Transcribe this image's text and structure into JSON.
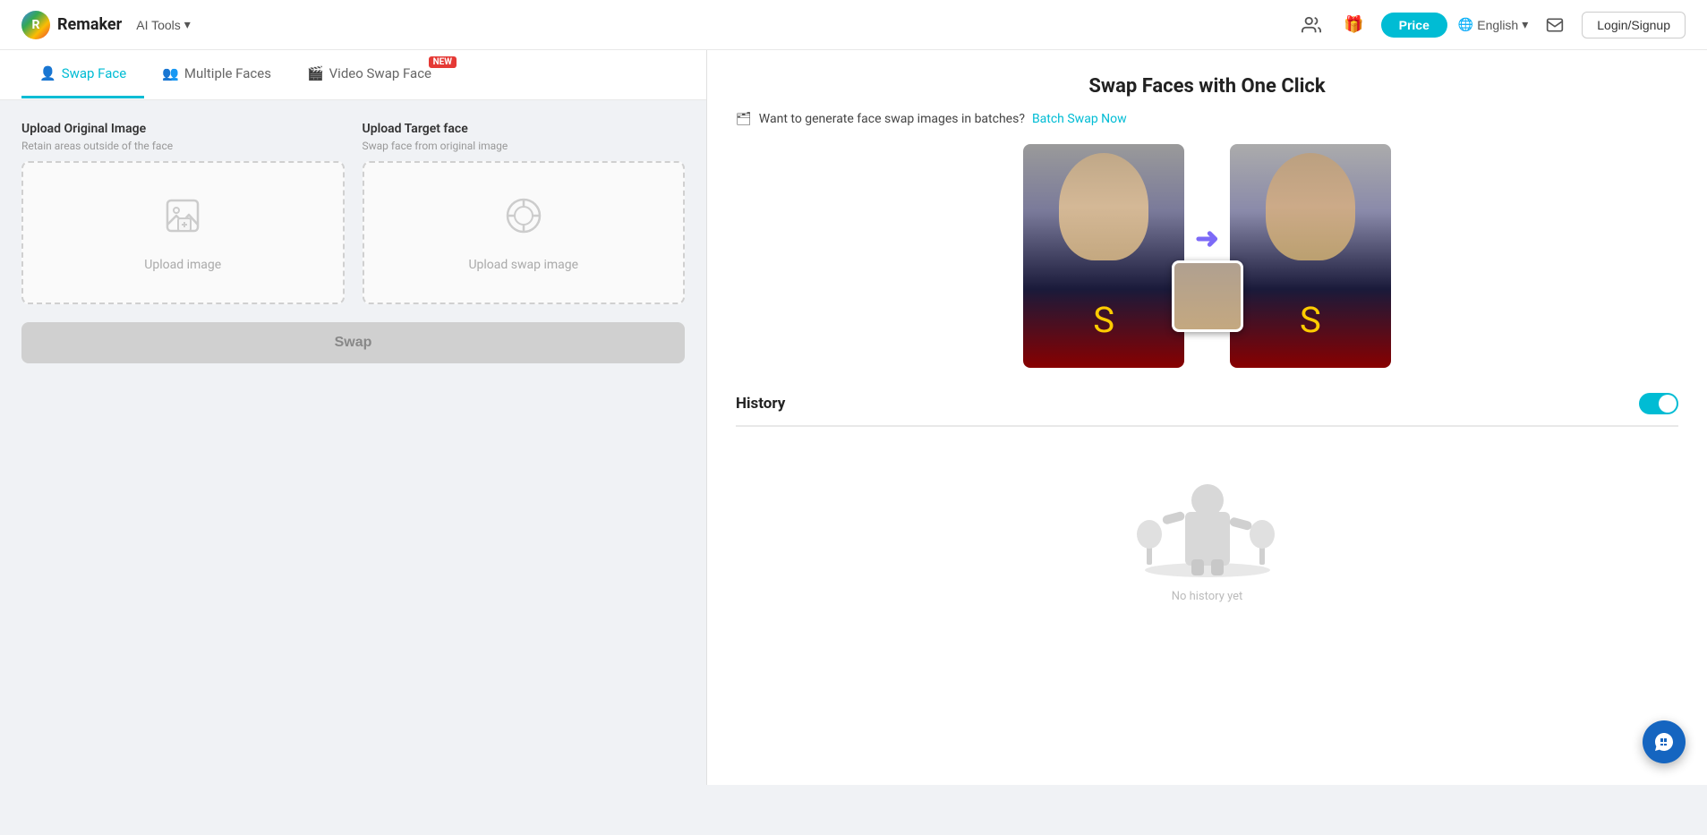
{
  "header": {
    "brand": "Remaker",
    "ai_tools_label": "AI Tools",
    "price_label": "Price",
    "language": "English",
    "login_label": "Login/Signup"
  },
  "tabs": [
    {
      "id": "swap-face",
      "label": "Swap Face",
      "active": true,
      "icon": "👤",
      "badge": null
    },
    {
      "id": "multiple-faces",
      "label": "Multiple Faces",
      "active": false,
      "icon": "👥",
      "badge": null
    },
    {
      "id": "video-swap-face",
      "label": "Video Swap Face",
      "active": false,
      "icon": "🎬",
      "badge": "NEW"
    }
  ],
  "upload": {
    "original": {
      "label": "Upload Original Image",
      "sublabel": "Retain areas outside of the face",
      "placeholder": "Upload image"
    },
    "target": {
      "label": "Upload Target face",
      "sublabel": "Swap face from original image",
      "placeholder": "Upload swap image"
    },
    "swap_button": "Swap"
  },
  "right_panel": {
    "title": "Swap Faces with One Click",
    "batch_text": "Want to generate face swap images in batches?",
    "batch_link": "Batch Swap Now",
    "history_title": "History",
    "empty_history_text": "No history yet"
  }
}
